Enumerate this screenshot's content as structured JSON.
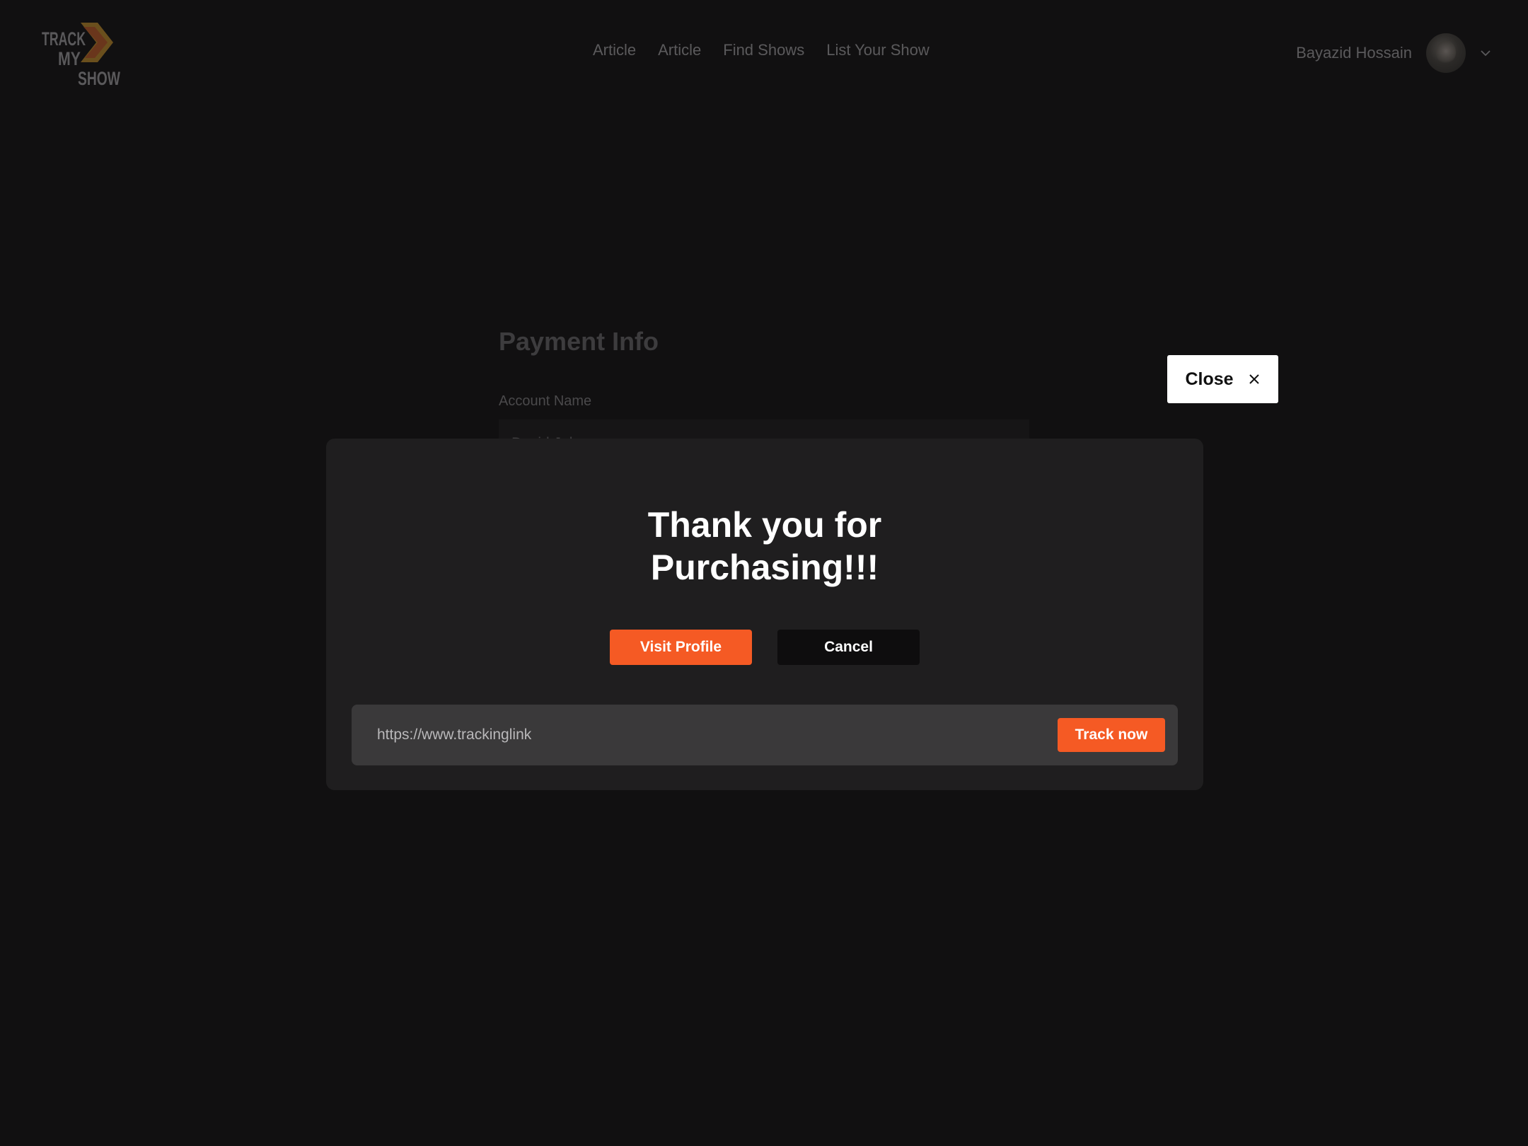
{
  "header": {
    "logo_text": [
      "TRACK",
      "MY",
      "SHOW"
    ],
    "nav": [
      {
        "label": "Article"
      },
      {
        "label": "Article"
      },
      {
        "label": "Find Shows"
      },
      {
        "label": "List Your Show"
      }
    ],
    "user": {
      "name": "Bayazid Hossain",
      "avatar_icon": "user-avatar",
      "menu_icon": "chevron-down-icon"
    }
  },
  "background_form": {
    "title": "Payment Info",
    "account_name_label": "Account Name",
    "account_name_value": "David John"
  },
  "modal": {
    "title_line1": "Thank you for",
    "title_line2": "Purchasing!!!",
    "visit_profile_label": "Visit Profile",
    "cancel_label": "Cancel",
    "tracking_url": "https://www.trackinglink",
    "track_now_label": "Track now"
  },
  "close": {
    "label": "Close",
    "icon": "close-icon"
  },
  "colors": {
    "accent": "#f55a24",
    "background": "#111011",
    "modal": "#1f1e1f"
  }
}
